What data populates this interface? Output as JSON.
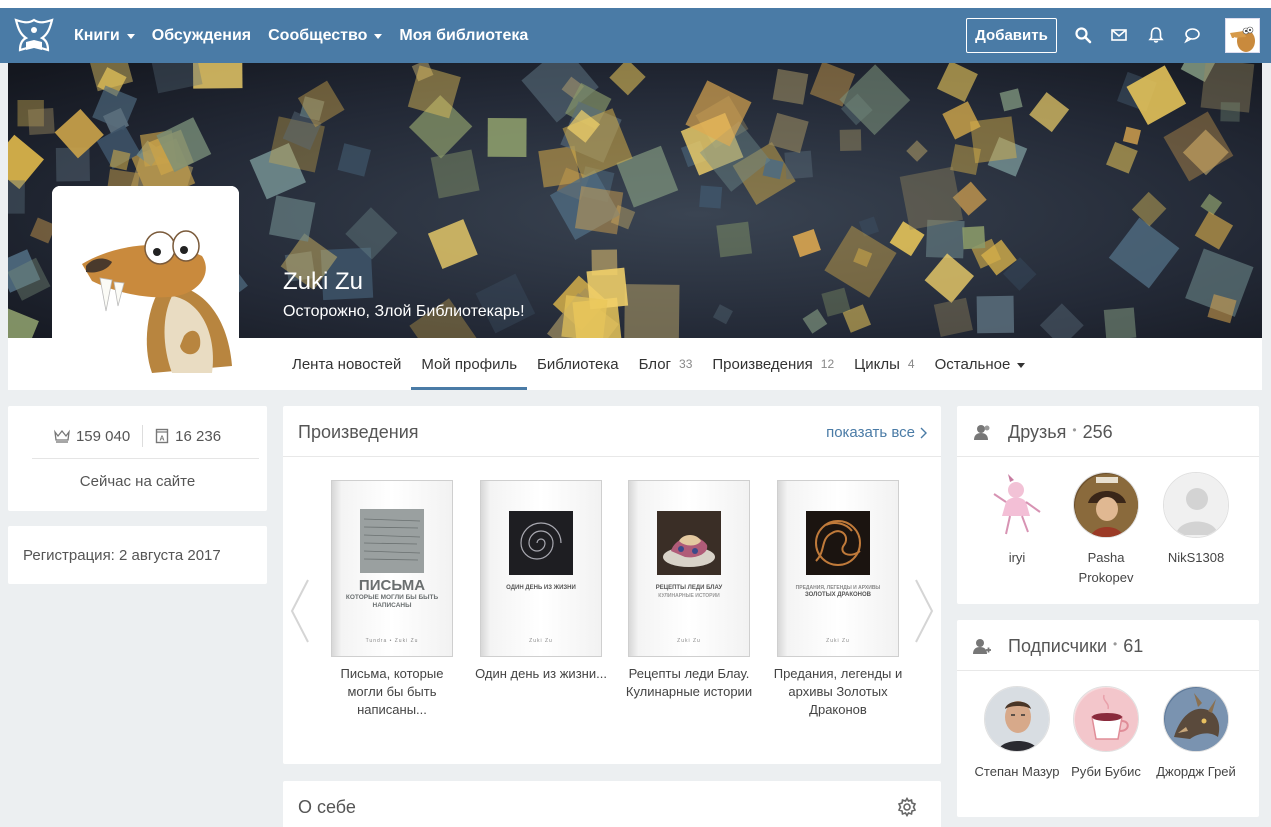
{
  "navbar": {
    "items": [
      {
        "label": "Книги",
        "dropdown": true
      },
      {
        "label": "Обсуждения",
        "dropdown": false
      },
      {
        "label": "Сообщество",
        "dropdown": true
      },
      {
        "label": "Моя библиотека",
        "dropdown": false
      }
    ],
    "add_label": "Добавить",
    "color": "#4a7ba6"
  },
  "profile": {
    "name": "Zuki Zu",
    "status": "Осторожно, Злой Библиотекарь!"
  },
  "tabs": [
    {
      "label": "Лента новостей",
      "count": ""
    },
    {
      "label": "Мой профиль",
      "count": ""
    },
    {
      "label": "Библиотека",
      "count": ""
    },
    {
      "label": "Блог",
      "count": "33"
    },
    {
      "label": "Произведения",
      "count": "12"
    },
    {
      "label": "Циклы",
      "count": "4"
    },
    {
      "label": "Остальное",
      "count": ""
    }
  ],
  "stats": {
    "rating": "159 040",
    "books": "16 236",
    "online": "Сейчас на сайте"
  },
  "registration": "Регистрация: 2 августа 2017",
  "works": {
    "title": "Произведения",
    "show_all": "показать все",
    "books": [
      {
        "label": "Письма, которые могли бы быть написаны...",
        "cover_title": "ПИСЬМА",
        "cover_sub": "КОТОРЫЕ МОГЛИ БЫ БЫТЬ НАПИСАНЫ",
        "cover_author": "Tundra • Zuki Zu"
      },
      {
        "label": "Один день из жизни...",
        "cover_title": "ОДИН ДЕНЬ ИЗ ЖИЗНИ",
        "cover_sub": "",
        "cover_author": "Zuki Zu"
      },
      {
        "label": "Рецепты леди Блау. Кулинарные истории",
        "cover_title": "РЕЦЕПТЫ ЛЕДИ БЛАУ",
        "cover_sub": "КУЛИНАРНЫЕ ИСТОРИИ",
        "cover_author": "Zuki Zu"
      },
      {
        "label": "Предания, легенды и архивы Золотых Драконов",
        "cover_title": "ЗОЛОТЫХ ДРАКОНОВ",
        "cover_sub": "ПРЕДАНИЯ, ЛЕГЕНДЫ И АРХИВЫ",
        "cover_author": "Zuki Zu"
      }
    ]
  },
  "about": {
    "title": "О себе"
  },
  "friends": {
    "title": "Друзья",
    "count": "256",
    "people": [
      {
        "name": "iryi"
      },
      {
        "name": "Pasha Prokopev"
      },
      {
        "name": "NikS1308"
      }
    ]
  },
  "subscribers": {
    "title": "Подписчики",
    "count": "61",
    "people": [
      {
        "name": "Степан Мазур"
      },
      {
        "name": "Руби Бубис"
      },
      {
        "name": "Джордж Грей"
      }
    ]
  }
}
